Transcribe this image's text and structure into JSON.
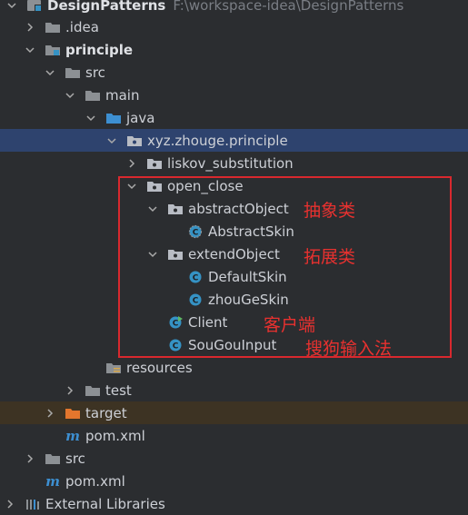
{
  "tree": {
    "root": {
      "name": "DesignPatterns",
      "path": "F:\\workspace-idea\\DesignPatterns"
    },
    "idea": "idea",
    "principle": "principle",
    "src1": "src",
    "main": "main",
    "java": "java",
    "pkg": "xyz.zhouge.principle",
    "liskov": "liskov_substitution",
    "open_close": "open_close",
    "abstractObject": "abstractObject",
    "AbstractSkin": "AbstractSkin",
    "extendObject": "extendObject",
    "DefaultSkin": "DefaultSkin",
    "zhouGeSkin": "zhouGeSkin",
    "Client": "Client",
    "SouGouInput": "SouGouInput",
    "resources": "resources",
    "test": "test",
    "target": "target",
    "pom1": "pom.xml",
    "src2": "src",
    "pom2": "pom.xml",
    "ext": "External Libraries"
  },
  "annotations": {
    "abstract": "抽象类",
    "extend": "拓展类",
    "client": "客户端",
    "input": "搜狗输入法"
  },
  "colors": {
    "background": "#2b2d30",
    "selection": "#2e436e",
    "excluded": "#3d3323",
    "folder": "#8c9094",
    "package": "#b8bcc4",
    "class": "#3592c4",
    "annotation_red": "#e8312f"
  }
}
